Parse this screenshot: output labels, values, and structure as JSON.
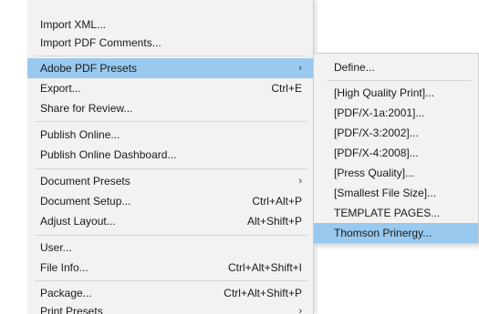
{
  "main_menu": {
    "items": [
      {
        "label": "Import XML...",
        "shortcut": ""
      },
      {
        "label": "Import PDF Comments...",
        "shortcut": ""
      },
      {
        "label": "Adobe PDF Presets",
        "shortcut": "",
        "submenu_arrow": "›"
      },
      {
        "label": "Export...",
        "shortcut": "Ctrl+E"
      },
      {
        "label": "Share for Review...",
        "shortcut": ""
      },
      {
        "label": "Publish Online...",
        "shortcut": ""
      },
      {
        "label": "Publish Online Dashboard...",
        "shortcut": ""
      },
      {
        "label": "Document Presets",
        "shortcut": "",
        "submenu_arrow": "›"
      },
      {
        "label": "Document Setup...",
        "shortcut": "Ctrl+Alt+P"
      },
      {
        "label": "Adjust Layout...",
        "shortcut": "Alt+Shift+P"
      },
      {
        "label": "User...",
        "shortcut": ""
      },
      {
        "label": "File Info...",
        "shortcut": "Ctrl+Alt+Shift+I"
      },
      {
        "label": "Package...",
        "shortcut": "Ctrl+Alt+Shift+P"
      },
      {
        "label": "Print Presets",
        "shortcut": "",
        "submenu_arrow": "›"
      }
    ],
    "highlighted": "Adobe PDF Presets"
  },
  "sub_menu": {
    "items": [
      {
        "label": "Define..."
      },
      {
        "label": "[High Quality Print]..."
      },
      {
        "label": "[PDF/X-1a:2001]..."
      },
      {
        "label": "[PDF/X-3:2002]..."
      },
      {
        "label": "[PDF/X-4:2008]..."
      },
      {
        "label": "[Press Quality]..."
      },
      {
        "label": "[Smallest File Size]..."
      },
      {
        "label": "TEMPLATE PAGES..."
      },
      {
        "label": "Thomson Prinergy..."
      }
    ],
    "highlighted": "Thomson Prinergy..."
  },
  "colors": {
    "menu_background": "#f2f2f2",
    "highlight": "#99c9ef",
    "separator": "#d7d7d7",
    "text": "#1a1a1a"
  }
}
